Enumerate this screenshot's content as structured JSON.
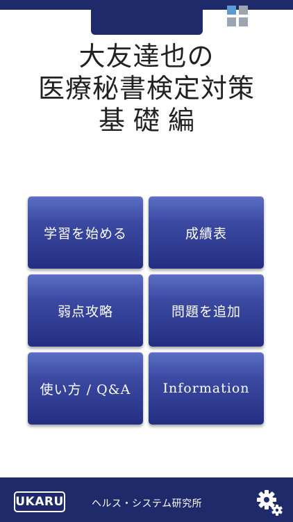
{
  "header": {
    "title_lines": [
      "大友達也の",
      "医療秘書検定対策",
      "基礎編"
    ],
    "icon": "grid-icon",
    "icon_colors": [
      "#5b9bd5",
      "#9aa5b1",
      "#9aa5b1",
      "#9aa5b1"
    ]
  },
  "menu": {
    "items": [
      {
        "label": "学習を始める"
      },
      {
        "label": "成績表"
      },
      {
        "label": "弱点攻略"
      },
      {
        "label": "問題を追加"
      },
      {
        "label": "使い方 / Q&A"
      },
      {
        "label": "Information"
      }
    ]
  },
  "footer": {
    "logo_text": "UKARU",
    "company": "ヘルス・システム研究所",
    "settings_icon": "gear-icon"
  },
  "colors": {
    "brand_navy": "#1f2a6b",
    "button_top": "#5c6ec4",
    "button_bottom": "#232f80",
    "text_dark": "#222222"
  }
}
